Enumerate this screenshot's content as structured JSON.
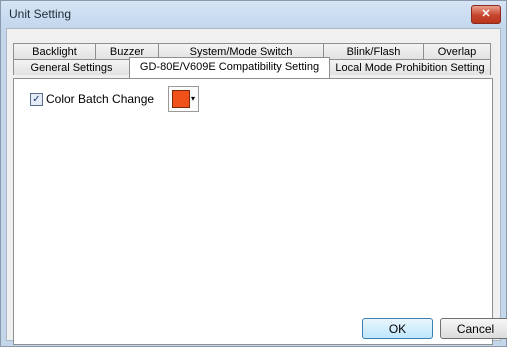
{
  "window": {
    "title": "Unit Setting",
    "close_glyph": "✕"
  },
  "tabs_row1": [
    "Backlight",
    "Buzzer",
    "System/Mode Switch",
    "Blink/Flash",
    "Overlap"
  ],
  "tabs_row2": [
    "General Settings",
    "GD-80E/V609E Compatibility Setting",
    "Local Mode Prohibition Setting"
  ],
  "active_tab": "GD-80E/V609E Compatibility Setting",
  "panel": {
    "checkbox_label": "Color Batch Change",
    "checkbox_checked": true,
    "checkbox_glyph": "✓",
    "color_value": "#f0501a",
    "dropdown_glyph": "▾"
  },
  "buttons": {
    "ok": "OK",
    "cancel": "Cancel"
  }
}
